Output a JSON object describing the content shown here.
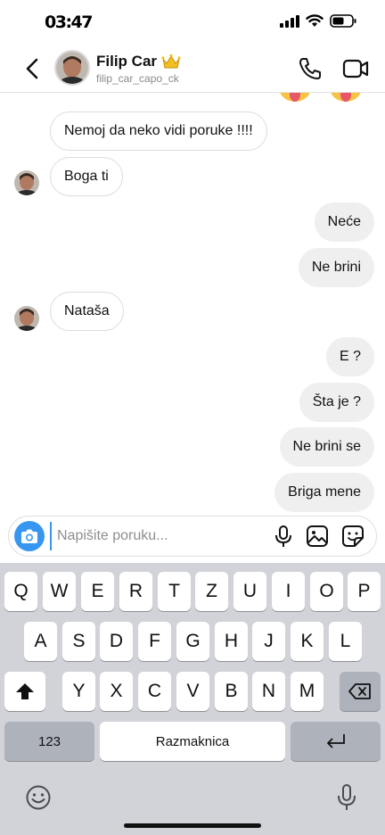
{
  "status_bar": {
    "time": "03:47"
  },
  "header": {
    "contact_name": "Filip Car",
    "contact_username": "filip_car_capo_ck"
  },
  "messages": [
    {
      "side": "in",
      "text": "Nemoj da neko vidi poruke !!!!"
    },
    {
      "side": "in",
      "text": "Boga ti"
    },
    {
      "side": "out",
      "text": "Neće"
    },
    {
      "side": "out",
      "text": "Ne brini"
    },
    {
      "side": "in",
      "text": "Nataša"
    },
    {
      "side": "out",
      "text": "E ?"
    },
    {
      "side": "out",
      "text": "Šta je ?"
    },
    {
      "side": "out",
      "text": "Ne brini se"
    },
    {
      "side": "out",
      "text": "Briga mene"
    }
  ],
  "composer": {
    "placeholder": "Napišite poruku..."
  },
  "keyboard": {
    "row1": [
      "Q",
      "W",
      "E",
      "R",
      "T",
      "Z",
      "U",
      "I",
      "O",
      "P"
    ],
    "row2": [
      "A",
      "S",
      "D",
      "F",
      "G",
      "H",
      "J",
      "K",
      "L"
    ],
    "row3": [
      "Y",
      "X",
      "C",
      "V",
      "B",
      "N",
      "M"
    ],
    "numbers_label": "123",
    "space_label": "Razmaknica"
  },
  "colors": {
    "accent": "#3797f0",
    "outgoing_bubble": "#efefef",
    "keyboard_bg": "#d1d3d9"
  },
  "icons": [
    "back-chevron",
    "phone",
    "video-camera",
    "camera",
    "microphone",
    "gallery",
    "sticker",
    "shift",
    "backspace",
    "return",
    "emoji",
    "dictation"
  ]
}
